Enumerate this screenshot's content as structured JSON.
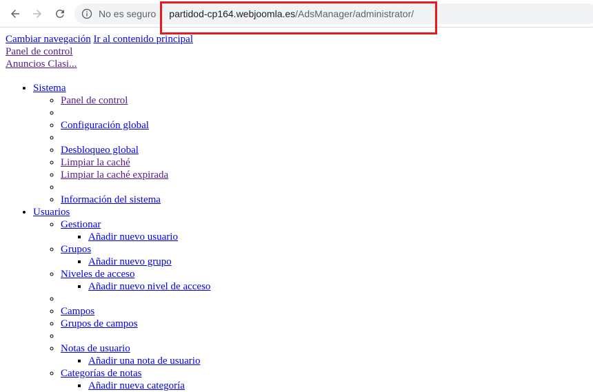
{
  "browser": {
    "security_label": "No es seguro",
    "url_host": "partidod-cp164.webjoomla.es",
    "url_path": "/AdsManager/administrator/",
    "highlight_color": "#e8191f"
  },
  "top_links": {
    "toggle_nav": "Cambiar navegación",
    "skip_content": "Ir al contenido principal",
    "control_panel": "Panel de control",
    "classifieds": "Anuncios Clasi..."
  },
  "menu": {
    "system": {
      "label": "Sistema",
      "items": [
        "Panel de control",
        "",
        "Configuración global",
        "",
        "Desbloqueo global",
        "Limpiar la caché",
        "Limpiar la caché expirada",
        "",
        "Información del sistema"
      ]
    },
    "users": {
      "label": "Usuarios",
      "manage": "Gestionar",
      "add_user": "Añadir nuevo usuario",
      "groups": "Grupos",
      "add_group": "Añadir nuevo grupo",
      "access_levels": "Niveles de acceso",
      "add_access_level": "Añadir nuevo nivel de acceso",
      "fields": "Campos",
      "field_groups": "Grupos de campos",
      "user_notes": "Notas de usuario",
      "add_user_note": "Añadir una nota de usuario",
      "note_categories": "Categorías de notas",
      "add_category_partial": "Añadir nueva categoría"
    }
  }
}
